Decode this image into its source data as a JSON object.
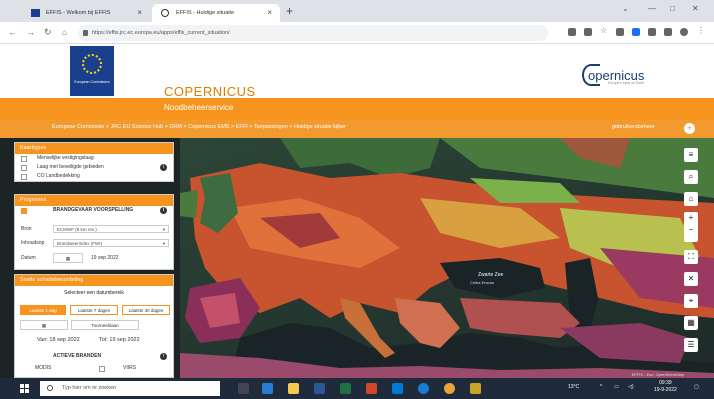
{
  "browser": {
    "tabs": [
      {
        "title": "EFFIS - Welkom bij EFFIS"
      },
      {
        "title": "EFFIS - Huidige situatie"
      }
    ],
    "url": "https://effis.jrc.ec.europa.eu/apps/effis_current_situation/",
    "new_tab": "+"
  },
  "site": {
    "eu_logo_text": "European Commission",
    "brand": "COPERNICUS",
    "service": "Noodbeheerservice",
    "partner_logo": "opernicus",
    "partner_tagline": "Europe's eyes on Earth",
    "breadcrumb": "Europese Commissie > JRC EU Science Hub > DRM > Copernicus EMS > EFFI > Toepassingen > Huidige situatie kijker",
    "user": "gebruikersbeheer"
  },
  "panels": {
    "maptypes": {
      "title": "Kaarttypes",
      "items": [
        "Menselijke vestigingslaag",
        "Laag met beveiligde gebieden",
        "CO Landbedekking"
      ]
    },
    "forecast": {
      "title": "Prognoses",
      "header": "BRANDGEVAAR VOORSPELLING",
      "source_label": "Bron",
      "source_value": "ECMWF (8 km res.)",
      "index_label": "Inhoudsop",
      "index_value": "Brandweerindex (FWI)",
      "date_label": "Datum",
      "date_value": "19 sep 2022"
    },
    "damage": {
      "title": "Snelle schadebeoordeling",
      "select_range": "Selecteer een datumbereik",
      "btn_1day": "Laatste 1 dag",
      "btn_7day": "Laatste 7 dagen",
      "btn_30day": "Laatste 30 dagen",
      "btn_custom": "Tourneeblaan",
      "from": "Van: 18 sep 2022",
      "to": "Tot: 19 sep 2022",
      "active_fires": "ACTIEVE BRANDEN",
      "modis": "MODIS",
      "viirs": "VIIRS"
    }
  },
  "map_labels": {
    "sea1": "Zwarte Zee",
    "sea2": "Ceiba Ensola",
    "attribution": "EFFIS - Esri, OpenStreetMap"
  },
  "taskbar": {
    "search": "Typ hier om te zoeken",
    "weather": "13°C",
    "time": "09:39",
    "date": "19-9-2022"
  }
}
